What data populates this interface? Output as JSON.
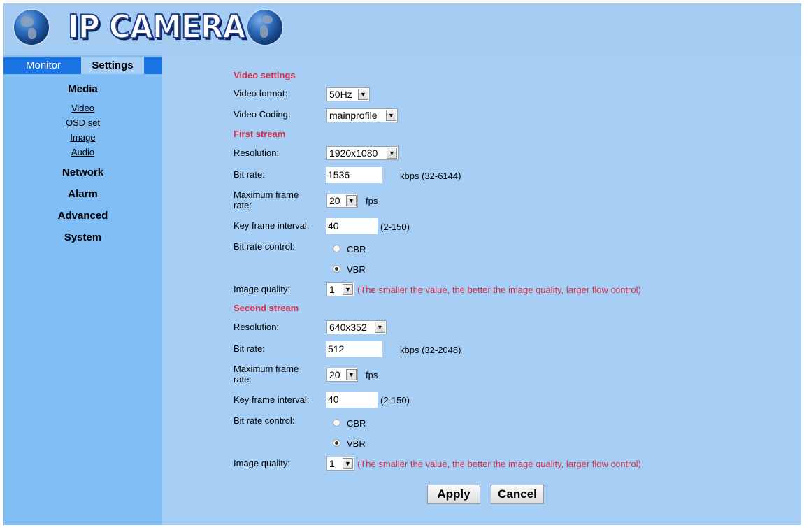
{
  "header": {
    "title": "IP CAMERA"
  },
  "tabs": {
    "monitor": "Monitor",
    "settings": "Settings"
  },
  "sidebar": {
    "media": "Media",
    "media_items": [
      "Video",
      "OSD set",
      "Image",
      "Audio"
    ],
    "network": "Network",
    "alarm": "Alarm",
    "advanced": "Advanced",
    "system": "System"
  },
  "video_settings": {
    "heading": "Video settings",
    "format_label": "Video format:",
    "format_value": "50Hz",
    "coding_label": "Video Coding:",
    "coding_value": "mainprofile"
  },
  "first_stream": {
    "heading": "First stream",
    "resolution_label": "Resolution:",
    "resolution_value": "1920x1080",
    "bitrate_label": "Bit rate:",
    "bitrate_value": "1536",
    "bitrate_hint": "kbps (32-6144)",
    "framerate_label_1": "Maximum frame",
    "framerate_label_2": "rate:",
    "framerate_value": "20",
    "framerate_unit": "fps",
    "keyframe_label": "Key frame interval:",
    "keyframe_value": "40",
    "keyframe_hint": "(2-150)",
    "control_label": "Bit rate control:",
    "cbr": "CBR",
    "vbr": "VBR",
    "quality_label": "Image quality:",
    "quality_value": "1",
    "quality_note": "(The smaller the value, the better the image quality, larger flow control)"
  },
  "second_stream": {
    "heading": "Second stream",
    "resolution_label": "Resolution:",
    "resolution_value": "640x352",
    "bitrate_label": "Bit rate:",
    "bitrate_value": "512",
    "bitrate_hint": "kbps (32-2048)",
    "framerate_label_1": "Maximum frame",
    "framerate_label_2": "rate:",
    "framerate_value": "20",
    "framerate_unit": "fps",
    "keyframe_label": "Key frame interval:",
    "keyframe_value": "40",
    "keyframe_hint": "(2-150)",
    "control_label": "Bit rate control:",
    "cbr": "CBR",
    "vbr": "VBR",
    "quality_label": "Image quality:",
    "quality_value": "1",
    "quality_note": "(The smaller the value, the better the image quality, larger flow control)"
  },
  "buttons": {
    "apply": "Apply",
    "cancel": "Cancel"
  },
  "colors": {
    "accent_red": "#d3304a",
    "tab_blue": "#1b74e4",
    "panel_blue": "#a7cff5"
  }
}
